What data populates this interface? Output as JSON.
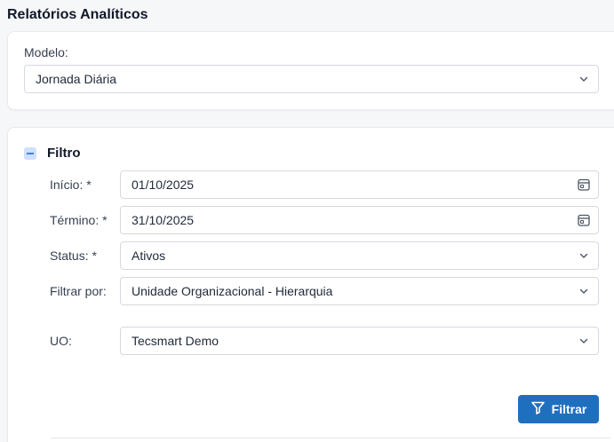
{
  "page": {
    "title": "Relatórios Analíticos"
  },
  "model": {
    "label": "Modelo:",
    "value": "Jornada Diária"
  },
  "filter": {
    "title": "Filtro",
    "start": {
      "label": "Início: *",
      "value": "01/10/2025"
    },
    "end": {
      "label": "Término: *",
      "value": "31/10/2025"
    },
    "status": {
      "label": "Status: *",
      "value": "Ativos"
    },
    "filter_by": {
      "label": "Filtrar por:",
      "value": "Unidade Organizacional - Hierarquia"
    },
    "uo": {
      "label": "UO:",
      "value": "Tecsmart Demo"
    },
    "button": {
      "label": "Filtrar"
    }
  },
  "icons": {
    "chevron": "chevron-down-icon",
    "calendar": "calendar-icon",
    "funnel": "filter-icon",
    "collapse": "minus-square-icon"
  },
  "colors": {
    "primary_button": "#1f6fbf",
    "collapse_icon": "#3b82f6"
  }
}
